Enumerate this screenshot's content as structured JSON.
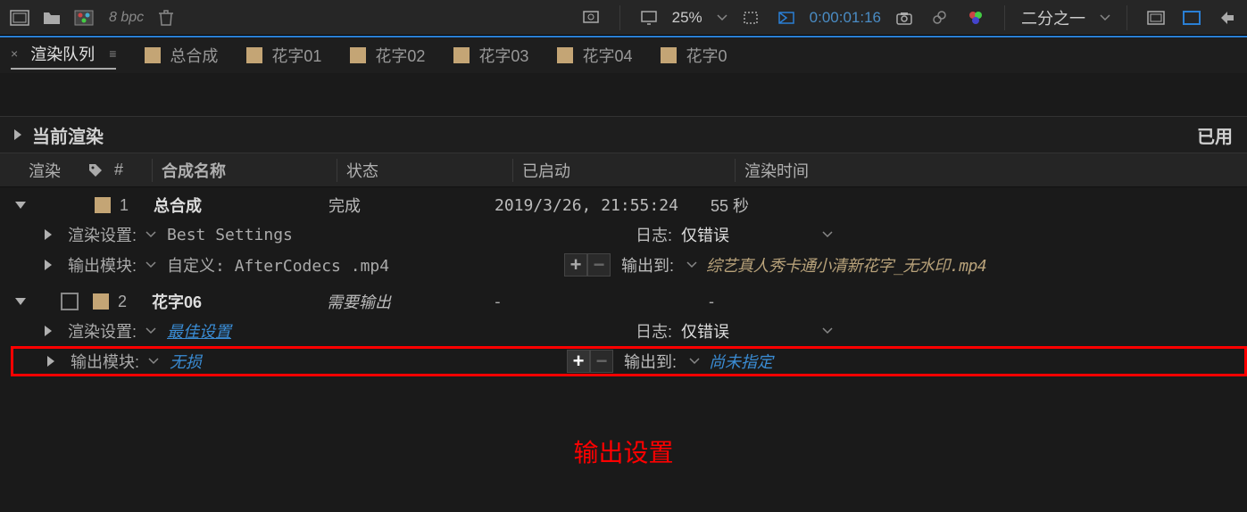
{
  "toolbar": {
    "bpc": "8 bpc",
    "zoom": "25%",
    "timecode": "0:00:01:16",
    "resolution": "二分之一"
  },
  "tabs": {
    "active": "渲染队列",
    "items": [
      "总合成",
      "花字01",
      "花字02",
      "花字03",
      "花字04",
      "花字0"
    ]
  },
  "currentRender": {
    "label": "当前渲染",
    "usedLabel": "已用"
  },
  "queueHeader": {
    "render": "渲染",
    "num": "#",
    "compName": "合成名称",
    "status": "状态",
    "started": "已启动",
    "renderTime": "渲染时间"
  },
  "items": [
    {
      "num": "1",
      "name": "总合成",
      "status": "完成",
      "started": "2019/3/26, 21:55:24",
      "renderTime": "55 秒",
      "renderSettings": {
        "label": "渲染设置:",
        "value": "Best Settings"
      },
      "outputModule": {
        "label": "输出模块:",
        "value": "自定义: AfterCodecs .mp4"
      },
      "log": {
        "label": "日志:",
        "value": "仅错误"
      },
      "outputTo": {
        "label": "输出到:",
        "value": "综艺真人秀卡通小清新花字_无水印.mp4"
      }
    },
    {
      "num": "2",
      "name": "花字06",
      "status": "需要输出",
      "started": "-",
      "renderTime": "-",
      "renderSettings": {
        "label": "渲染设置:",
        "value": "最佳设置"
      },
      "outputModule": {
        "label": "输出模块:",
        "value": "无损"
      },
      "log": {
        "label": "日志:",
        "value": "仅错误"
      },
      "outputTo": {
        "label": "输出到:",
        "value": "尚未指定"
      }
    }
  ],
  "annotation": "输出设置"
}
